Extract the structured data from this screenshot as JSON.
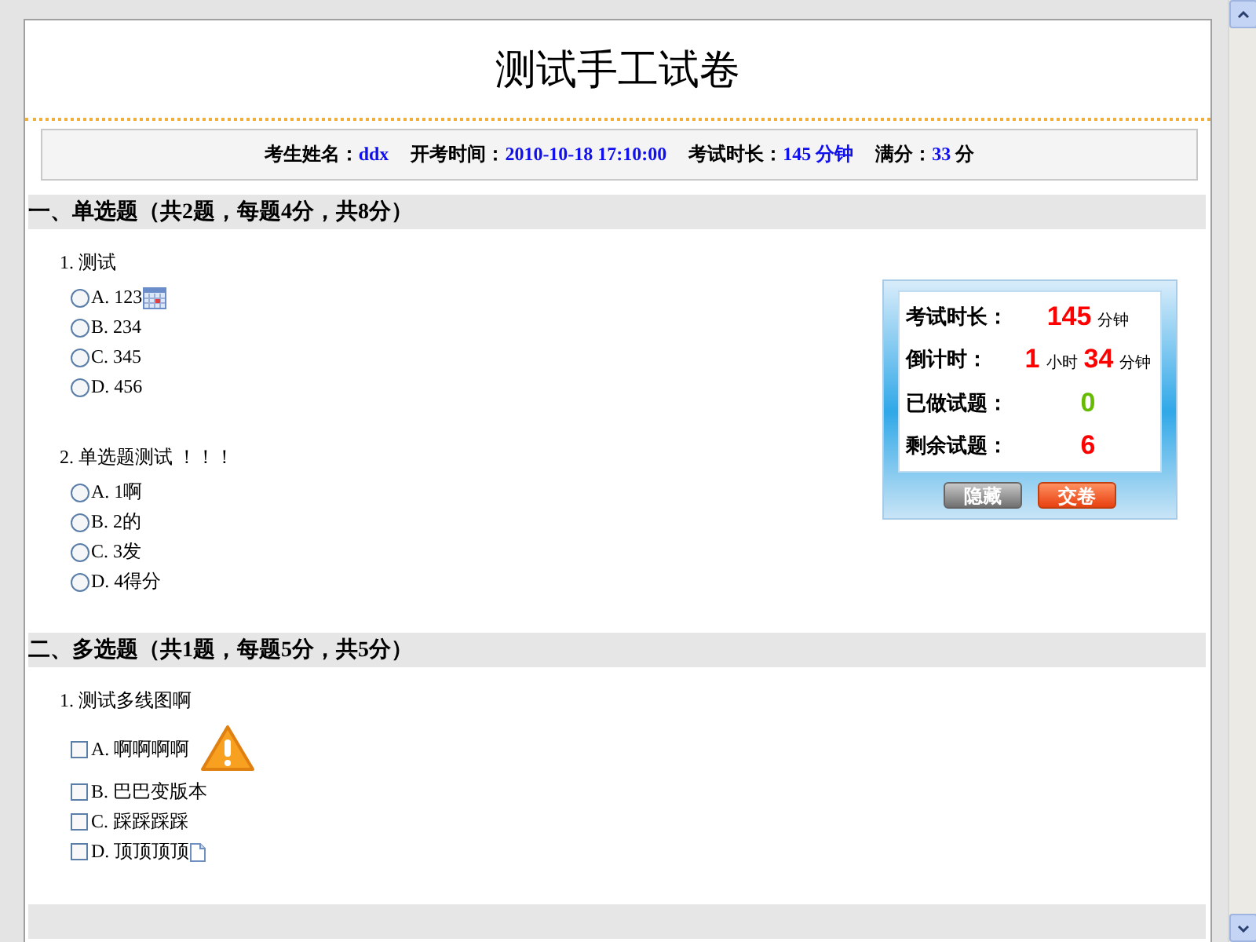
{
  "title": "测试手工试卷",
  "info": [
    {
      "label": "考生姓名：",
      "value": "ddx"
    },
    {
      "label": "开考时间：",
      "value": "2010-10-18 17:10:00"
    },
    {
      "label": "考试时长：",
      "value": "145 分钟"
    },
    {
      "label": "满分：",
      "value": "33",
      "unit": "分"
    }
  ],
  "sections": [
    {
      "heading": "一、单选题（共2题，每题4分，共8分）",
      "questions": [
        {
          "text": "1. 测试",
          "kind": "radio",
          "options": [
            {
              "label": "A. 123",
              "checked": false,
              "kind": "calendar"
            },
            {
              "label": "B. 234",
              "checked": false,
              "kind": "plain"
            },
            {
              "label": "C. 345",
              "checked": false,
              "kind": "plain"
            },
            {
              "label": "D. 456",
              "checked": false,
              "kind": "plain"
            }
          ]
        },
        {
          "text": "2. 单选题测试 ！！！",
          "kind": "radio",
          "options": [
            {
              "label": "A. 1啊",
              "checked": false,
              "kind": "plain"
            },
            {
              "label": "B. 2的",
              "checked": false,
              "kind": "plain"
            },
            {
              "label": "C. 3发",
              "checked": false,
              "kind": "plain"
            },
            {
              "label": "D. 4得分",
              "checked": false,
              "kind": "plain"
            }
          ]
        }
      ]
    },
    {
      "heading": "二、多选题（共1题，每题5分，共5分）",
      "questions": [
        {
          "text": "1. 测试多线图啊",
          "kind": "checkbox",
          "options": [
            {
              "label": "A. 啊啊啊啊",
              "checked": false,
              "kind": "warning"
            },
            {
              "label": "B. 巴巴变版本",
              "checked": false,
              "kind": "plain"
            },
            {
              "label": "C. 踩踩踩踩",
              "checked": false,
              "kind": "plain"
            },
            {
              "label": "D. 顶顶顶顶",
              "checked": false,
              "kind": "file"
            }
          ]
        }
      ]
    }
  ],
  "panel": {
    "rows": [
      {
        "label": "考试时长：",
        "color": "#ff0000",
        "parts": [
          {
            "value": "145",
            "unit": "分钟"
          }
        ]
      },
      {
        "label": "倒计时：",
        "color": "#ff0000",
        "parts": [
          {
            "value": "1",
            "unit": "小时"
          },
          {
            "value": "34",
            "unit": "分钟"
          }
        ]
      },
      {
        "label": "已做试题：",
        "color": "#66bb00",
        "parts": [
          {
            "value": "0"
          }
        ]
      },
      {
        "label": "剩余试题：",
        "color": "#ff0000",
        "parts": [
          {
            "value": "6"
          }
        ]
      }
    ],
    "buttons": [
      {
        "label": "隐藏",
        "kind": "secondary"
      },
      {
        "label": "交卷",
        "kind": "primary"
      }
    ]
  }
}
